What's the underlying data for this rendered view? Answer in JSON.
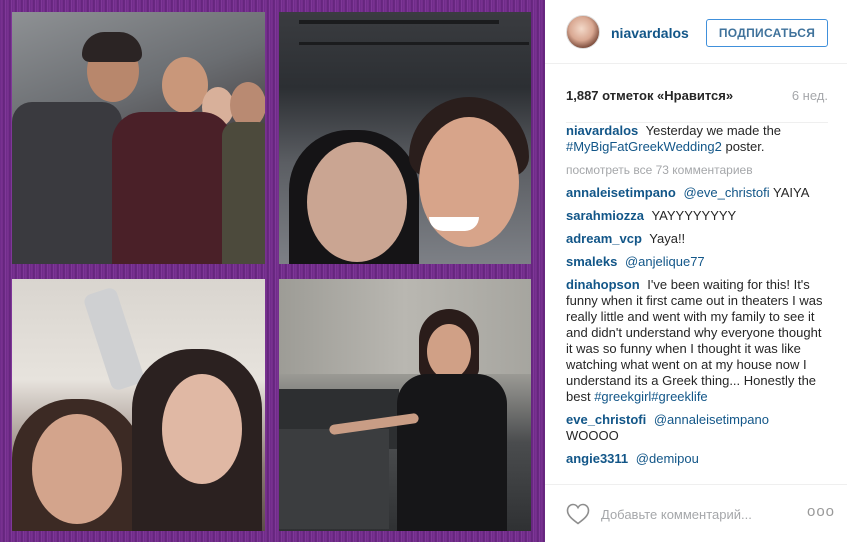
{
  "header": {
    "username": "niavardalos",
    "follow_label": "ПОДПИСАТЬСЯ"
  },
  "stats": {
    "likes": "1,887 отметок «Нравится»",
    "age": "6 нед."
  },
  "caption": {
    "username": "niavardalos",
    "text": "Yesterday we made the",
    "hashtag": "#MyBigFatGreekWedding2",
    "text_end": "poster."
  },
  "view_all": "посмотреть все 73 комментариев",
  "comments": [
    {
      "user": "annaleisetimpano",
      "mention": "@eve_christofi",
      "text": "YAIYA"
    },
    {
      "user": "sarahmiozza",
      "mention": "",
      "text": "YAYYYYYYYY"
    },
    {
      "user": "adream_vcp",
      "mention": "",
      "text": "Yaya!!"
    },
    {
      "user": "smaleks",
      "mention": "@anjelique77",
      "text": ""
    },
    {
      "user": "dinahopson",
      "mention": "",
      "text": "I've been waiting for this! It's funny when it first came out in theaters I was really little and went with my family to see it and didn't understand why everyone thought it was so funny when I thought it was like watching what went on at my house now I understand its a Greek thing... Honestly the best",
      "hashtags": "#greekgirl#greeklife"
    },
    {
      "user": "eve_christofi",
      "mention": "@annaleisetimpano",
      "text": "WOOOO"
    },
    {
      "user": "angie3311",
      "mention": "@demipou",
      "text": ""
    }
  ],
  "footer": {
    "add_comment_placeholder": "Добавьте комментарий...",
    "more_glyph": "ooo",
    "heart_icon": "heart-outline-icon"
  },
  "colors": {
    "username": "#125688",
    "frame": "#6d2a86",
    "follow_border": "#4090db"
  }
}
